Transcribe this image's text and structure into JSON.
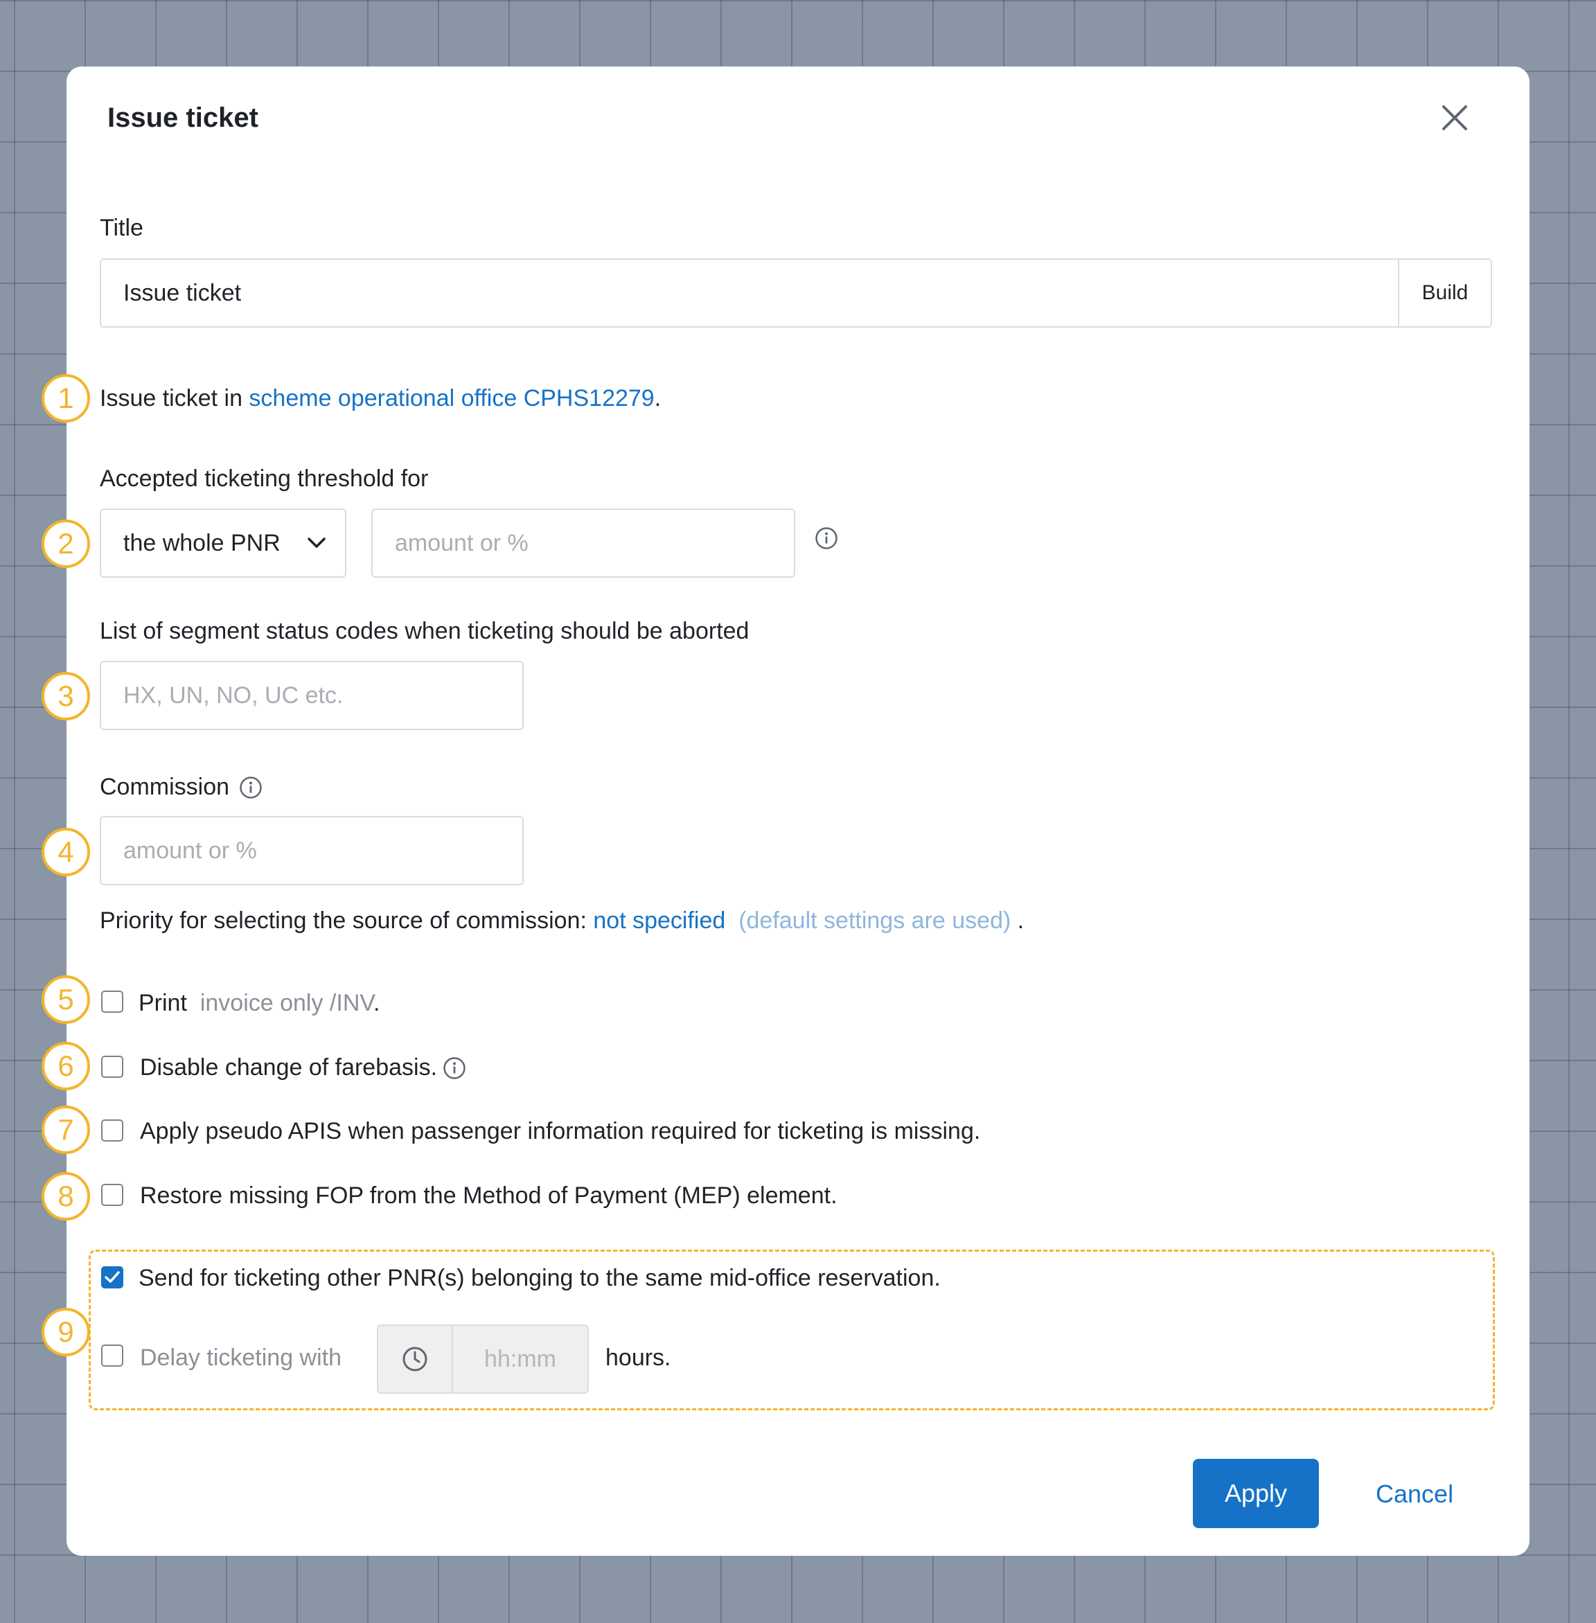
{
  "dialog": {
    "title": "Issue ticket"
  },
  "title_field": {
    "label": "Title",
    "value": "Issue ticket",
    "build_label": "Build"
  },
  "office_line": {
    "prefix": "Issue ticket in ",
    "link": "scheme operational office CPHS12279",
    "suffix": "."
  },
  "threshold": {
    "label": "Accepted ticketing threshold for",
    "select_value": "the whole PNR",
    "placeholder": "amount or %"
  },
  "segment_status": {
    "label": "List of segment status codes when ticketing should be aborted",
    "placeholder": "HX, UN, NO, UC etc."
  },
  "commission": {
    "label": "Commission",
    "placeholder": "amount or %"
  },
  "priority_line": {
    "prefix": "Priority for selecting the source of commission: ",
    "link": "not specified",
    "note": "(default settings are used)",
    "suffix": "."
  },
  "options": {
    "print_label": "Print",
    "print_value": "invoice only /INV",
    "print_suffix": ".",
    "farebasis_label": "Disable change of farebasis.",
    "pseudo_apis_label": "Apply pseudo APIS when passenger information required for ticketing is missing.",
    "restore_fop_label": "Restore missing FOP from the Method of Payment (MEP) element.",
    "send_other_label": "Send for ticketing other PNR(s) belonging to the same mid-office reservation.",
    "send_other_checked": true,
    "delay_label": "Delay ticketing with",
    "delay_placeholder": "hh:mm",
    "delay_suffix": "hours."
  },
  "badges": [
    "1",
    "2",
    "3",
    "4",
    "5",
    "6",
    "7",
    "8",
    "9"
  ],
  "footer": {
    "apply_label": "Apply",
    "cancel_label": "Cancel"
  },
  "colors": {
    "accent": "#1672c7",
    "badge": "#f2b52c",
    "backdrop": "#8a95a5"
  }
}
